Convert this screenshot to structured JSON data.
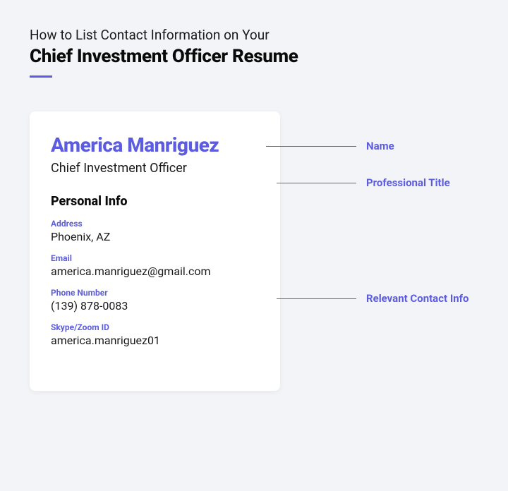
{
  "header": {
    "subtitle": "How to List Contact Information on Your",
    "title": "Chief Investment Officer Resume"
  },
  "card": {
    "name": "America Manriguez",
    "title": "Chief Investment Officer",
    "section_heading": "Personal Info",
    "fields": {
      "address": {
        "label": "Address",
        "value": "Phoenix, AZ"
      },
      "email": {
        "label": "Email",
        "value": "america.manriguez@gmail.com"
      },
      "phone": {
        "label": "Phone Number",
        "value": "(139) 878-0083"
      },
      "skype": {
        "label": "Skype/Zoom ID",
        "value": "america.manriguez01"
      }
    }
  },
  "annotations": {
    "name": "Name",
    "title": "Professional Title",
    "contact": "Relevant Contact Info"
  }
}
